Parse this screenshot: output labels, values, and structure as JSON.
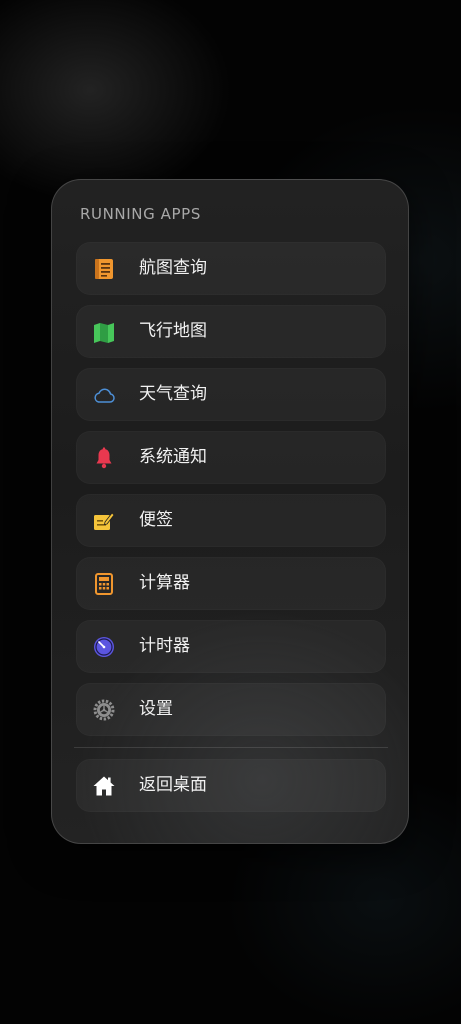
{
  "panel": {
    "title": "RUNNING APPS",
    "apps": [
      {
        "label": "航图查询",
        "icon": "document-icon",
        "color": "#f0962e"
      },
      {
        "label": "飞行地图",
        "icon": "map-icon",
        "color": "#47c65a"
      },
      {
        "label": "天气查询",
        "icon": "cloud-icon",
        "color": "#4d8fd6"
      },
      {
        "label": "系统通知",
        "icon": "bell-icon",
        "color": "#e8384f"
      },
      {
        "label": "便签",
        "icon": "memo-icon",
        "color": "#f5c43a"
      },
      {
        "label": "计算器",
        "icon": "calculator-icon",
        "color": "#f0962e"
      },
      {
        "label": "计时器",
        "icon": "timer-icon",
        "color": "#5b55e0"
      },
      {
        "label": "设置",
        "icon": "gear-icon",
        "color": "#8e8e8e"
      }
    ],
    "home": {
      "label": "返回桌面",
      "icon": "home-icon",
      "color": "#ffffff"
    }
  }
}
